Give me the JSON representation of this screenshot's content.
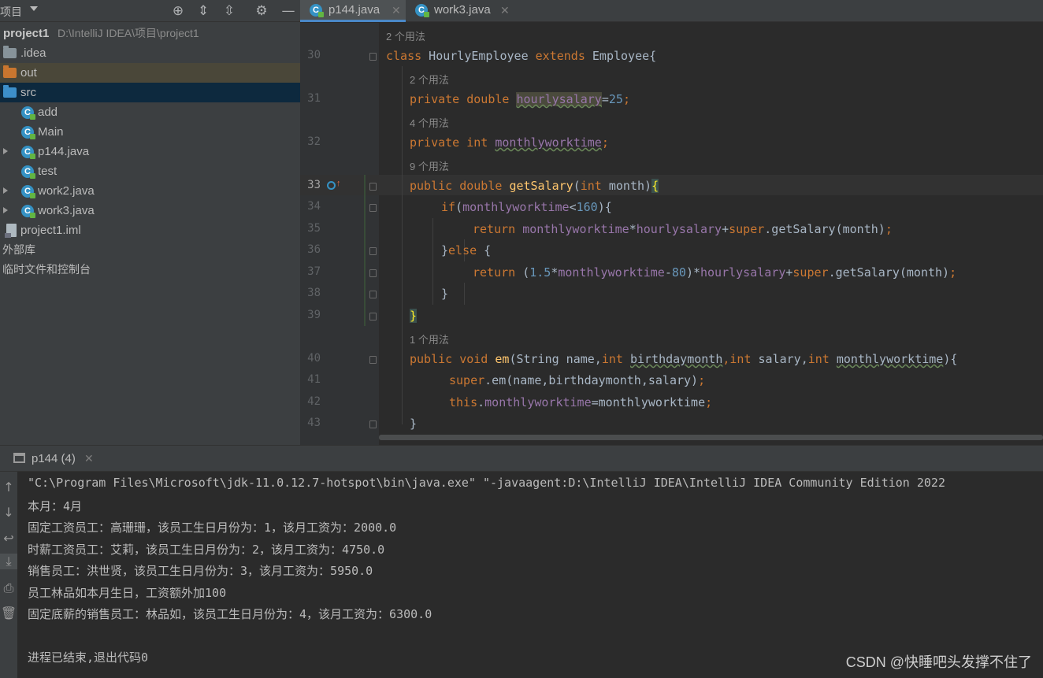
{
  "project_toolbar": {
    "title": "项目",
    "icons": [
      "crosshair-icon",
      "expand-all-icon",
      "collapse-all-icon",
      "gear-icon",
      "minimize-icon"
    ]
  },
  "project_tree": {
    "root_name": "project1",
    "root_path": "D:\\IntelliJ IDEA\\项目\\project1",
    "items": [
      {
        "label": ".idea",
        "type": "folder"
      },
      {
        "label": "out",
        "type": "folder-excluded"
      },
      {
        "label": "src",
        "type": "folder-source"
      },
      {
        "label": "add",
        "type": "class"
      },
      {
        "label": "Main",
        "type": "class"
      },
      {
        "label": "p144.java",
        "type": "class"
      },
      {
        "label": "test",
        "type": "class"
      },
      {
        "label": "work2.java",
        "type": "class"
      },
      {
        "label": "work3.java",
        "type": "class"
      },
      {
        "label": "project1.iml",
        "type": "iml"
      }
    ],
    "external_libs": "外部库",
    "scratches": "临时文件和控制台"
  },
  "editor_tabs": [
    {
      "label": "p144.java",
      "active": true
    },
    {
      "label": "work3.java",
      "active": false
    }
  ],
  "editor": {
    "usage_hints": [
      "2 个用法",
      "2 个用法",
      "4 个用法",
      "9 个用法",
      "1 个用法"
    ],
    "line_numbers": [
      "30",
      "31",
      "32",
      "33",
      "34",
      "35",
      "36",
      "37",
      "38",
      "39",
      "40",
      "41",
      "42",
      "43"
    ],
    "current_line": "33",
    "code_tokens": {
      "class_kw": "class",
      "class_name": " HourlyEmployee ",
      "extends_kw": "extends",
      "parent": " Employee{",
      "private_double": "private double ",
      "hourlysalary": "hourlysalary",
      "eq25": "=",
      "n25": "25",
      "semi": ";",
      "private_int": "private int ",
      "monthlyworktime": "monthlyworktime",
      "public_double": "public double ",
      "getSalary": "getSalary",
      "int_kw": "int",
      "month_param": " month)",
      "lparen": "(",
      "open_brace": "{",
      "if_kw": "if",
      "lt": "<",
      "n160": "160",
      "close_if": "){",
      "return_kw": "return ",
      "star": "*",
      "plus": "+",
      "super_kw": "super",
      "dot_getSalary_month": ".getSalary(month)",
      "else_close": "}",
      "else_kw": "else",
      "else_open": " {",
      "lp": "(",
      "n15": "1.5",
      "minus": "-",
      "n80": "80",
      "rp": ")",
      "close_brace": "}",
      "public_void": "public void ",
      "em": "em",
      "string_name": "(String name,",
      "birthdaymonth": "birthdaymonth",
      "comma": ",",
      "salary_param": " salary,",
      "close_em": "){",
      "super_em": ".em(name,birthdaymonth,salary)",
      "this_kw": "this",
      "dot": ".",
      "assign_mwt": "=monthlyworktime"
    }
  },
  "run_panel": {
    "tab_label": "p144 (4)",
    "console_lines": [
      "\"C:\\Program Files\\Microsoft\\jdk-11.0.12.7-hotspot\\bin\\java.exe\" \"-javaagent:D:\\IntelliJ IDEA\\IntelliJ IDEA Community Edition 2022",
      "本月：4月",
      "固定工资员工：高珊珊，该员工生日月份为：1，该月工资为：2000.0",
      "时薪工资员工：艾莉，该员工生日月份为：2，该月工资为：4750.0",
      "销售员工：洪世贤，该员工生日月份为：3，该月工资为：5950.0",
      "员工林品如本月生日，工资额外加100",
      "固定底薪的销售员工：林品如，该员工生日月份为：4，该月工资为：6300.0",
      "",
      "进程已结束,退出代码0"
    ]
  },
  "watermark": "CSDN @快睡吧头发撑不住了"
}
